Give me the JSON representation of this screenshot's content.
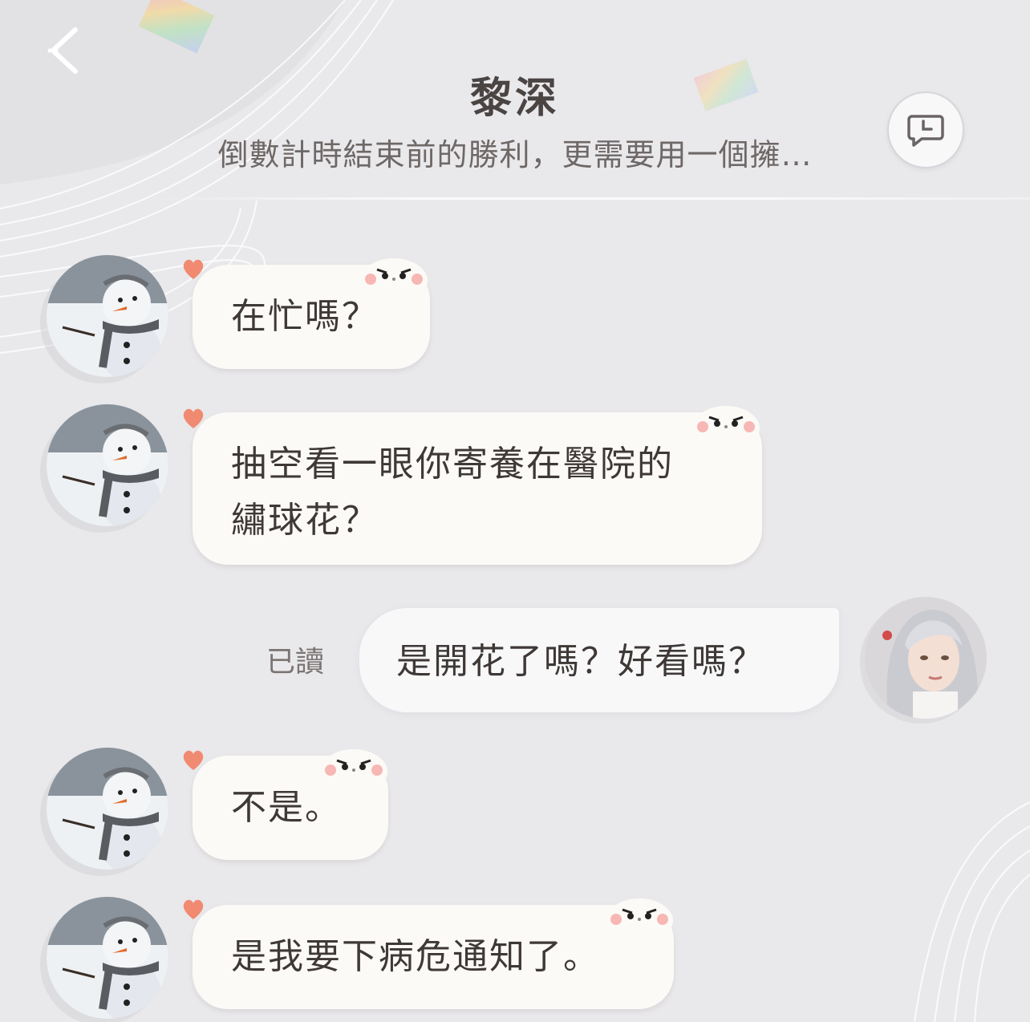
{
  "header": {
    "title": "黎深",
    "subtitle": "倒數計時結束前的勝利，更需要用一個擁…",
    "back_icon": "chevron-left-icon",
    "history_icon": "chat-history-icon"
  },
  "messages": [
    {
      "sender": "contact",
      "text_lines": [
        "在忙嗎？"
      ]
    },
    {
      "sender": "contact",
      "text_lines": [
        "抽空看一眼你寄養在醫院的",
        "繡球花？"
      ]
    },
    {
      "sender": "me",
      "text_lines": [
        "是開花了嗎？好看嗎？"
      ],
      "status": "已讀"
    },
    {
      "sender": "contact",
      "text_lines": [
        "不是。"
      ]
    },
    {
      "sender": "contact",
      "text_lines": [
        "是我要下病危通知了。"
      ]
    }
  ],
  "colors": {
    "background": "#e9e8eb",
    "bubble_contact": "#fcfaf6",
    "bubble_me": "#f7f7f9",
    "heart_accent": "#f08a70",
    "text": "#3e3836"
  }
}
